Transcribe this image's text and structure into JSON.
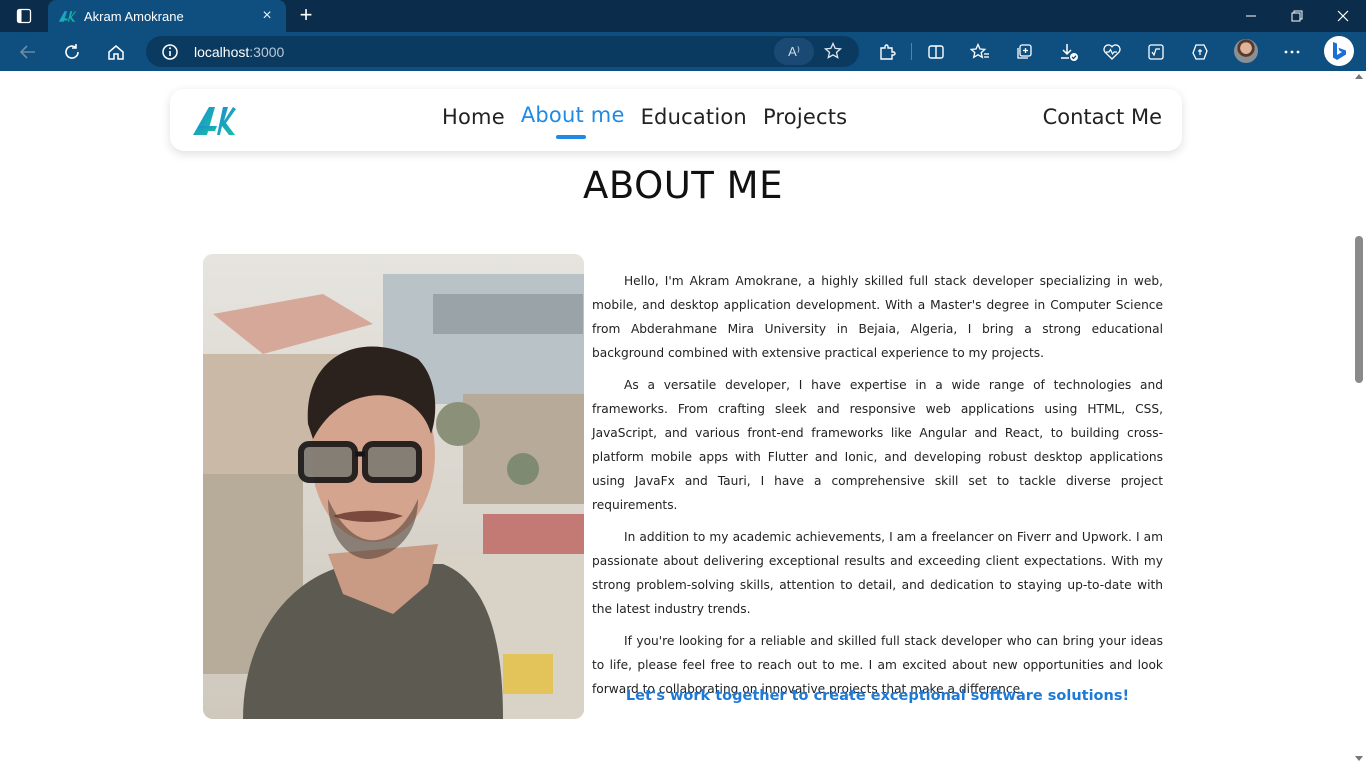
{
  "browser": {
    "tab_title": "Akram Amokrane",
    "tab_close": "×",
    "new_tab": "+",
    "address_host": "localhost",
    "address_port": ":3000",
    "read_aloud": "A⁾"
  },
  "nav": {
    "links": [
      "Home",
      "About me",
      "Education",
      "Projects"
    ],
    "contact": "Contact Me",
    "accent": "#1f8ae6"
  },
  "about": {
    "title": "ABOUT ME",
    "paragraphs": [
      "Hello, I'm Akram Amokrane, a highly skilled full stack developer specializing in web, mobile, and desktop application development. With a Master's degree in Computer Science from Abderahmane Mira University in Bejaia, Algeria, I bring a strong educational background combined with extensive practical experience to my projects.",
      "As a versatile developer, I have expertise in a wide range of technologies and frameworks. From crafting sleek and responsive web applications using HTML, CSS, JavaScript, and various front-end frameworks like Angular and React, to building cross-platform mobile apps with Flutter and Ionic, and developing robust desktop applications using JavaFx and Tauri, I have a comprehensive skill set to tackle diverse project requirements.",
      "In addition to my academic achievements, I am a freelancer on Fiverr and Upwork. I am passionate about delivering exceptional results and exceeding client expectations. With my strong problem-solving skills, attention to detail, and dedication to staying up-to-date with the latest industry trends.",
      "If you're looking for a reliable and skilled full stack developer who can bring your ideas to life, please feel free to reach out to me. I am excited about new opportunities and look forward to collaborating on innovative projects that make a difference."
    ],
    "cta": "Let's work together to create exceptional software solutions!"
  },
  "icons": {
    "tab_actions": "tab-actions-icon",
    "back": "back-arrow-icon",
    "refresh": "refresh-icon",
    "home": "home-icon",
    "info": "info-icon",
    "favorite": "star-icon",
    "extensions": "puzzle-icon",
    "split": "split-screen-icon",
    "favorites": "favorites-icon",
    "collections": "collections-icon",
    "downloads": "download-icon",
    "performance": "heartbeat-icon",
    "math": "math-solver-icon",
    "copilot": "copilot-icon",
    "more": "more-icon",
    "bing": "bing-icon"
  }
}
